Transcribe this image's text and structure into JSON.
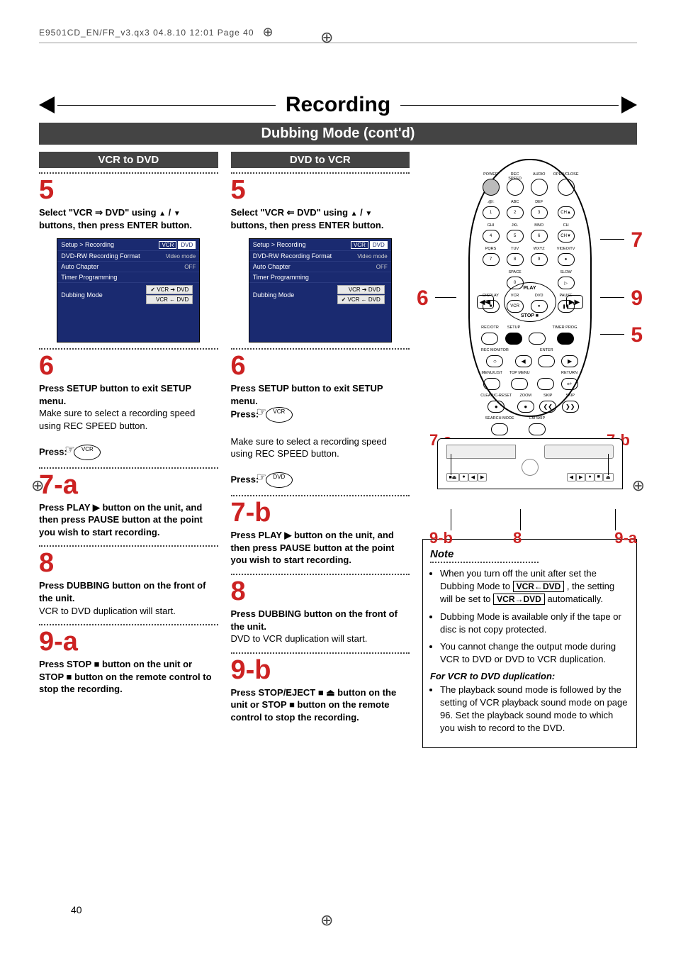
{
  "header_line": "E9501CD_EN/FR_v3.qx3  04.8.10  12:01  Page 40",
  "page_number": "40",
  "title": "Recording",
  "subtitle": "Dubbing Mode (cont'd)",
  "left": {
    "heading": "VCR to DVD",
    "step5": {
      "num": "5",
      "text_a": "Select \"VCR ⇒ DVD\" using ",
      "text_b": " / ",
      "text_c": " buttons, then press ENTER button."
    },
    "setup": {
      "path": "Setup > Recording",
      "tab_a": "VCR",
      "tab_b": "DVD",
      "rows": [
        {
          "k": "DVD-RW Recording Format",
          "v": "Video mode"
        },
        {
          "k": "Auto Chapter",
          "v": "OFF"
        },
        {
          "k": "Timer Programming",
          "v": ""
        },
        {
          "k": "Dubbing Mode",
          "v": ""
        }
      ],
      "opt_sel": "VCR ➔ DVD",
      "opt_other": "VCR ← DVD"
    },
    "step6": {
      "num": "6",
      "bold": "Press SETUP button to exit SETUP menu.",
      "plain": "Make sure to select a recording speed using REC SPEED button.",
      "press": "Press:",
      "icon": "VCR"
    },
    "step7": {
      "num": "7-a",
      "text": "Press PLAY ▶ button on the unit, and then press PAUSE button at the point you wish to start recording."
    },
    "step8": {
      "num": "8",
      "bold": "Press DUBBING button on the front of the unit.",
      "plain": "VCR to DVD duplication will start."
    },
    "step9": {
      "num": "9-a",
      "text": "Press STOP ■ button on the unit or STOP ■ button on the remote control to stop the recording."
    }
  },
  "mid": {
    "heading": "DVD to VCR",
    "step5": {
      "num": "5",
      "text_a": "Select \"VCR ⇐ DVD\" using ",
      "text_b": " / ",
      "text_c": " buttons, then press ENTER button."
    },
    "setup": {
      "path": "Setup > Recording",
      "tab_a": "VCR",
      "tab_b": "DVD",
      "rows": [
        {
          "k": "DVD-RW Recording Format",
          "v": "Video mode"
        },
        {
          "k": "Auto Chapter",
          "v": "OFF"
        },
        {
          "k": "Timer Programming",
          "v": ""
        },
        {
          "k": "Dubbing Mode",
          "v": ""
        }
      ],
      "opt_other": "VCR ➔ DVD",
      "opt_sel": "VCR ← DVD"
    },
    "step6": {
      "num": "6",
      "bold": "Press SETUP button to exit SETUP menu.",
      "press1": "Press:",
      "icon1": "VCR",
      "plain": "Make sure to select a recording speed using REC SPEED button.",
      "press2": "Press:",
      "icon2": "DVD"
    },
    "step7": {
      "num": "7-b",
      "text": "Press PLAY ▶ button on the unit, and then press PAUSE button at the point you wish to start recording."
    },
    "step8": {
      "num": "8",
      "bold": "Press DUBBING button on the front of the unit.",
      "plain": "DVD to VCR duplication will start."
    },
    "step9": {
      "num": "9-b",
      "text": "Press STOP/EJECT ■ ⏏ button on the unit or STOP ■ button on the remote control to stop the recording."
    }
  },
  "remote": {
    "labels_row1": [
      "POWER",
      "REC SPEED",
      "AUDIO",
      "OPEN/CLOSE"
    ],
    "labels_row2": [
      ".@/:",
      "ABC",
      "DEF",
      ""
    ],
    "nums_row2": [
      "1",
      "2",
      "3",
      "CH▲"
    ],
    "labels_row3": [
      "GHI",
      "JKL",
      "MNO",
      "CH"
    ],
    "nums_row3": [
      "4",
      "5",
      "6",
      "CH▼"
    ],
    "labels_row4": [
      "PQRS",
      "TUV",
      "WXYZ",
      "VIDEO/TV"
    ],
    "nums_row4": [
      "7",
      "8",
      "9",
      "●"
    ],
    "labels_row5": [
      "",
      "SPACE",
      "",
      "SLOW"
    ],
    "nums_row5": [
      "",
      "0",
      "",
      "▷"
    ],
    "labels_row6": [
      "DISPLAY",
      "VCR",
      "DVD",
      "PAUSE"
    ],
    "nums_row6": [
      "■",
      "VCR",
      "●",
      "❚❚"
    ],
    "nav_center": "PLAY",
    "nav_stop": "STOP ■",
    "lower": [
      [
        "REC/OTR",
        "SETUP",
        "",
        "TIMER PROG."
      ],
      [
        "REC MONITOR",
        "",
        "ENTER",
        ""
      ],
      [
        "MENU/LIST",
        "TOP MENU",
        "",
        "RETURN"
      ],
      [
        "CLEAR/C-RESET",
        "ZOOM",
        "SKIP",
        "SKIP"
      ],
      [
        "SEARCH MODE",
        "CM SKIP",
        "",
        ""
      ]
    ],
    "callout_7": "7",
    "callout_6": "6",
    "callout_9": "9",
    "callout_5": "5"
  },
  "front": {
    "l7a": "7-a",
    "l7b": "7-b",
    "l9b": "9-b",
    "l8": "8",
    "l9a": "9-a"
  },
  "note": {
    "head": "Note",
    "items": [
      "When you turn off the unit after set the Dubbing Mode to VCR←DVD , the setting will be set to VCR→DVD automatically.",
      "Dubbing Mode is available only if the tape or disc is not copy protected.",
      "You cannot change the output mode during VCR to DVD or DVD to VCR duplication."
    ],
    "sub_head": "For VCR to DVD duplication:",
    "sub_item": "The playback sound mode is followed by the setting of VCR playback sound mode on page 96. Set the playback sound mode to which you wish to record to the DVD."
  }
}
